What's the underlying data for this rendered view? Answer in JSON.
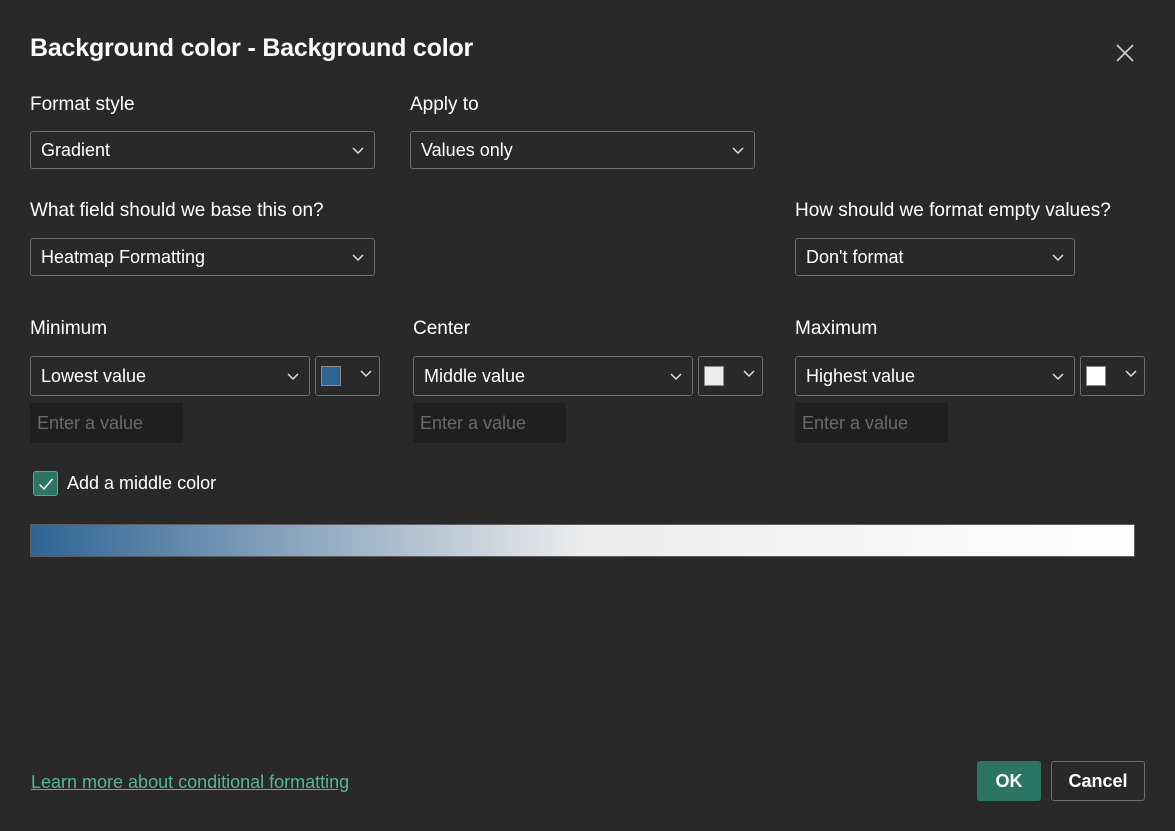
{
  "dialog": {
    "title": "Background color - Background color",
    "close_icon": "close-icon"
  },
  "format_style": {
    "label": "Format style",
    "selected": "Gradient"
  },
  "apply_to": {
    "label": "Apply to",
    "selected": "Values only"
  },
  "base_field": {
    "label": "What field should we base this on?",
    "selected": "Heatmap Formatting"
  },
  "empty_values": {
    "label": "How should we format empty values?",
    "selected": "Don't format"
  },
  "minimum": {
    "label": "Minimum",
    "selected": "Lowest value",
    "color": "#2f6495",
    "value_placeholder": "Enter a value"
  },
  "center": {
    "label": "Center",
    "selected": "Middle value",
    "color": "#ececec",
    "value_placeholder": "Enter a value"
  },
  "maximum": {
    "label": "Maximum",
    "selected": "Highest value",
    "color": "#ffffff",
    "value_placeholder": "Enter a value"
  },
  "middle_color": {
    "label": "Add a middle color",
    "checked": true
  },
  "footer": {
    "learn_more": "Learn more about conditional formatting",
    "ok": "OK",
    "cancel": "Cancel"
  },
  "colors": {
    "accent": "#2c7563",
    "link": "#57b59a",
    "background": "#292929"
  }
}
